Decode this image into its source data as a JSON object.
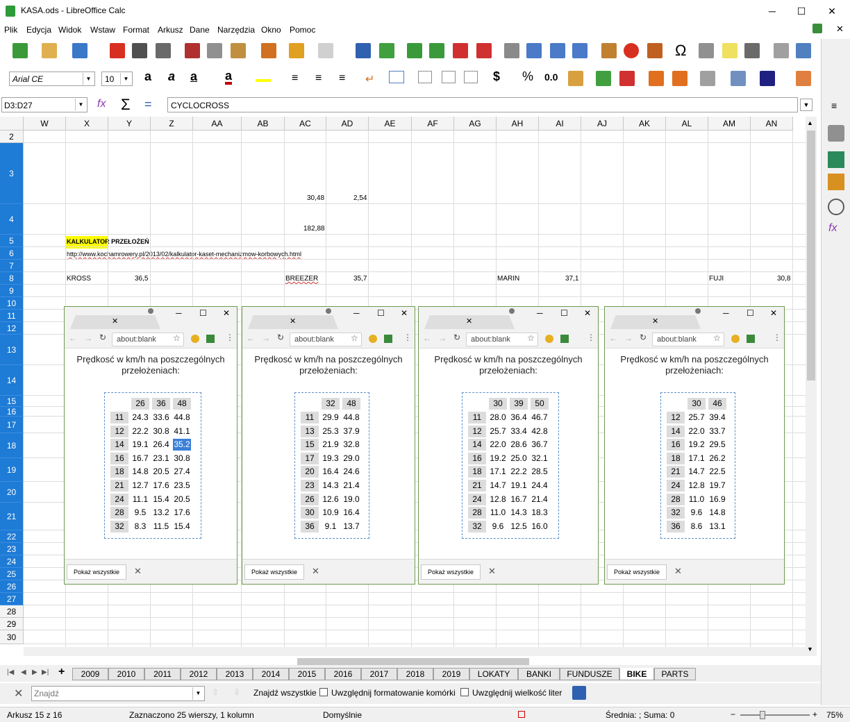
{
  "window": {
    "title": "KASA.ods - LibreOffice Calc",
    "minimize": "─",
    "maximize": "☐",
    "close": "✕"
  },
  "menu": [
    "Plik",
    "Edycja",
    "Widok",
    "Wstaw",
    "Format",
    "Arkusz",
    "Dane",
    "Narzędzia",
    "Okno",
    "Pomoc"
  ],
  "format_bar": {
    "font": "Arial CE",
    "size": "10",
    "currency": "$",
    "percent": "%",
    "number": "0.0"
  },
  "formula_bar": {
    "name_box": "D3:D27",
    "formula": "CYCLOCROSS"
  },
  "columns": [
    "W",
    "X",
    "Y",
    "Z",
    "AA",
    "AB",
    "AC",
    "AD",
    "AE",
    "AF",
    "AG",
    "AH",
    "AI",
    "AJ",
    "AK",
    "AL",
    "AM",
    "AN"
  ],
  "rows": [
    "2",
    "3",
    "4",
    "5",
    "6",
    "7",
    "8",
    "9",
    "10",
    "11",
    "12",
    "13",
    "14",
    "15",
    "16",
    "17",
    "18",
    "19",
    "20",
    "21",
    "22",
    "23",
    "24",
    "25",
    "26",
    "27",
    "28",
    "29",
    "30"
  ],
  "cells": {
    "ac3": "30,48",
    "ad3": "2,54",
    "ac4": "182,88",
    "x5": "KALKULATOR PRZEŁOŻEŃ",
    "x6": "http://www.kochamrowery.pl/2013/02/kalkulator-kaset-mechanizmow-korbowych.html",
    "x8": "KROSS",
    "y8": "36,5",
    "ac8": "BREEZER",
    "ad8": "35,7",
    "ah8": "MARIN",
    "ai8": "37,1",
    "am8": "FUJI",
    "an8": "30,8"
  },
  "popups": [
    {
      "url": "about:blank",
      "title_line1": "Prędkosć w km/h na poszczególnych",
      "title_line2": "przełożeniach:",
      "chainrings": [
        "26",
        "36",
        "48"
      ],
      "rows": [
        [
          "11",
          "24.3",
          "33.6",
          "44.8"
        ],
        [
          "12",
          "22.2",
          "30.8",
          "41.1"
        ],
        [
          "14",
          "19.1",
          "26.4",
          "35.2"
        ],
        [
          "16",
          "16.7",
          "23.1",
          "30.8"
        ],
        [
          "18",
          "14.8",
          "20.5",
          "27.4"
        ],
        [
          "21",
          "12.7",
          "17.6",
          "23.5"
        ],
        [
          "24",
          "11.1",
          "15.4",
          "20.5"
        ],
        [
          "28",
          "9.5",
          "13.2",
          "17.6"
        ],
        [
          "32",
          "8.3",
          "11.5",
          "15.4"
        ]
      ],
      "show_all": "Pokaż wszystkie",
      "close": "✕"
    },
    {
      "url": "about:blank",
      "title_line1": "Prędkosć w km/h na poszczególnych",
      "title_line2": "przełożeniach:",
      "chainrings": [
        "32",
        "48"
      ],
      "rows": [
        [
          "11",
          "29.9",
          "44.8"
        ],
        [
          "13",
          "25.3",
          "37.9"
        ],
        [
          "15",
          "21.9",
          "32.8"
        ],
        [
          "17",
          "19.3",
          "29.0"
        ],
        [
          "20",
          "16.4",
          "24.6"
        ],
        [
          "23",
          "14.3",
          "21.4"
        ],
        [
          "26",
          "12.6",
          "19.0"
        ],
        [
          "30",
          "10.9",
          "16.4"
        ],
        [
          "36",
          "9.1",
          "13.7"
        ]
      ],
      "show_all": "Pokaż wszystkie",
      "close": "✕"
    },
    {
      "url": "about:blank",
      "title_line1": "Prędkosć w km/h na poszczególnych",
      "title_line2": "przełożeniach:",
      "chainrings": [
        "30",
        "39",
        "50"
      ],
      "rows": [
        [
          "11",
          "28.0",
          "36.4",
          "46.7"
        ],
        [
          "12",
          "25.7",
          "33.4",
          "42.8"
        ],
        [
          "14",
          "22.0",
          "28.6",
          "36.7"
        ],
        [
          "16",
          "19.2",
          "25.0",
          "32.1"
        ],
        [
          "18",
          "17.1",
          "22.2",
          "28.5"
        ],
        [
          "21",
          "14.7",
          "19.1",
          "24.4"
        ],
        [
          "24",
          "12.8",
          "16.7",
          "21.4"
        ],
        [
          "28",
          "11.0",
          "14.3",
          "18.3"
        ],
        [
          "32",
          "9.6",
          "12.5",
          "16.0"
        ]
      ],
      "show_all": "Pokaż wszystkie",
      "close": "✕"
    },
    {
      "url": "about:blank",
      "title_line1": "Prędkosć w km/h na poszczególnych",
      "title_line2": "przełożeniach:",
      "chainrings": [
        "30",
        "46"
      ],
      "rows": [
        [
          "12",
          "25.7",
          "39.4"
        ],
        [
          "14",
          "22.0",
          "33.7"
        ],
        [
          "16",
          "19.2",
          "29.5"
        ],
        [
          "18",
          "17.1",
          "26.2"
        ],
        [
          "21",
          "14.7",
          "22.5"
        ],
        [
          "24",
          "12.8",
          "19.7"
        ],
        [
          "28",
          "11.0",
          "16.9"
        ],
        [
          "32",
          "9.6",
          "14.8"
        ],
        [
          "36",
          "8.6",
          "13.1"
        ]
      ],
      "show_all": "Pokaż wszystkie",
      "close": "✕"
    }
  ],
  "sheet_tabs": [
    "2009",
    "2010",
    "2011",
    "2012",
    "2013",
    "2014",
    "2015",
    "2016",
    "2017",
    "2018",
    "2019",
    "LOKATY",
    "BANKI",
    "FUNDUSZE",
    "BIKE",
    "PARTS"
  ],
  "active_tab": "BIKE",
  "find": {
    "placeholder": "Znajdź",
    "find_all": "Znajdź wszystkie",
    "opt1": "Uwzględnij formatowanie komórki",
    "opt2": "Uwzględnij wielkość liter"
  },
  "statusbar": {
    "sheet": "Arkusz 15 z 16",
    "selection": "Zaznaczono 25 wierszy, 1 kolumn",
    "style": "Domyślnie",
    "sum": "Średnia: ; Suma: 0",
    "zoom": "75%"
  },
  "colors": {
    "selection": "#1e7bd6",
    "highlight": "#ffff00",
    "popup_border": "#6d9a4e"
  }
}
